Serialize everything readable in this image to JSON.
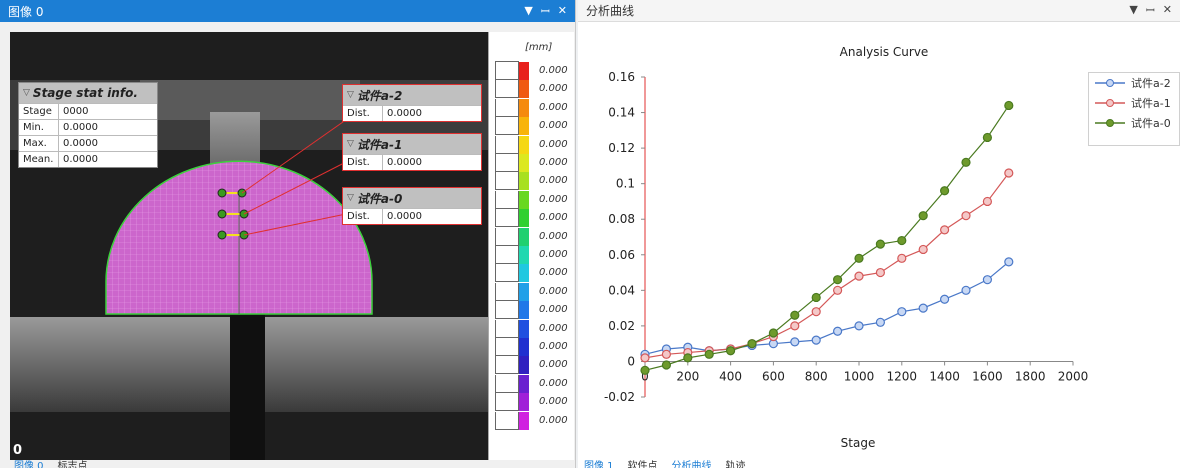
{
  "left_panel": {
    "title": "图像 0",
    "icons": {
      "dropdown": "▼",
      "pin": "ꟷ",
      "close": "✕"
    },
    "frame_label": "0",
    "stage_box": {
      "title": "Stage stat info.",
      "rows": [
        {
          "key": "Stage",
          "value": "0000"
        },
        {
          "key": "Min.",
          "value": "0.0000"
        },
        {
          "key": "Max.",
          "value": "0.0000"
        },
        {
          "key": "Mean.",
          "value": "0.0000"
        }
      ]
    },
    "specimens": [
      {
        "title": "试件a-2",
        "key": "Dist.",
        "value": "0.0000"
      },
      {
        "title": "试件a-1",
        "key": "Dist.",
        "value": "0.0000"
      },
      {
        "title": "试件a-0",
        "key": "Dist.",
        "value": "0.0000"
      }
    ],
    "bottom_tabs": [
      "图像 0",
      "标志点"
    ]
  },
  "scale_bar": {
    "unit": "[mm]",
    "values": [
      "0.000",
      "0.000",
      "0.000",
      "0.000",
      "0.000",
      "0.000",
      "0.000",
      "0.000",
      "0.000",
      "0.000",
      "0.000",
      "0.000",
      "0.000",
      "0.000",
      "0.000",
      "0.000",
      "0.000",
      "0.000",
      "0.000",
      "0.000"
    ],
    "colors": [
      "#e8201c",
      "#f05a12",
      "#f58a0e",
      "#f8b40a",
      "#f5d814",
      "#dce820",
      "#a8e020",
      "#68d820",
      "#30d030",
      "#20d070",
      "#20d8b0",
      "#20c8e0",
      "#20a0e8",
      "#2078e8",
      "#2050e0",
      "#2030d0",
      "#3020c0",
      "#6a20d0",
      "#a020d8",
      "#d020e0"
    ]
  },
  "right_panel": {
    "title": "分析曲线",
    "icons": {
      "dropdown": "▼",
      "pin": "ꟷ",
      "close": "✕"
    },
    "bottom_tabs": [
      "图像 1",
      "软件点",
      "分析曲线",
      "轨迹"
    ]
  },
  "chart_data": {
    "type": "scatter",
    "title": "Analysis Curve",
    "xlabel": "Stage",
    "ylabel": "",
    "xlim": [
      0,
      2000
    ],
    "ylim": [
      -0.02,
      0.16
    ],
    "xticks": [
      "0",
      "200",
      "400",
      "600",
      "800",
      "1000",
      "1200",
      "1400",
      "1600",
      "1800",
      "2000"
    ],
    "yticks": [
      "-0.02",
      "0",
      "0.02",
      "0.04",
      "0.06",
      "0.08",
      "0.1",
      "0.12",
      "0.14",
      "0.16"
    ],
    "grid": false,
    "legend_position": "top-right",
    "series": [
      {
        "name": "试件a-2",
        "color": "#4a78c8",
        "fill": "#c8d8f4",
        "x": [
          0,
          100,
          200,
          300,
          400,
          500,
          600,
          700,
          800,
          900,
          1000,
          1100,
          1200,
          1300,
          1400,
          1500,
          1600,
          1700
        ],
        "y": [
          0.004,
          0.007,
          0.008,
          0.006,
          0.007,
          0.009,
          0.01,
          0.011,
          0.012,
          0.017,
          0.02,
          0.022,
          0.028,
          0.03,
          0.035,
          0.04,
          0.046,
          0.056
        ]
      },
      {
        "name": "试件a-1",
        "color": "#d45858",
        "fill": "#f4c8c8",
        "x": [
          0,
          100,
          200,
          300,
          400,
          500,
          600,
          700,
          800,
          900,
          1000,
          1100,
          1200,
          1300,
          1400,
          1500,
          1600,
          1700
        ],
        "y": [
          0.002,
          0.004,
          0.005,
          0.006,
          0.007,
          0.01,
          0.014,
          0.02,
          0.028,
          0.04,
          0.048,
          0.05,
          0.058,
          0.063,
          0.074,
          0.082,
          0.09,
          0.106
        ]
      },
      {
        "name": "试件a-0",
        "color": "#4a7a20",
        "fill": "#6e9a2c",
        "x": [
          0,
          100,
          200,
          300,
          400,
          500,
          600,
          700,
          800,
          900,
          1000,
          1100,
          1200,
          1300,
          1400,
          1500,
          1600,
          1700
        ],
        "y": [
          -0.005,
          -0.002,
          0.002,
          0.004,
          0.006,
          0.01,
          0.016,
          0.026,
          0.036,
          0.046,
          0.058,
          0.066,
          0.068,
          0.082,
          0.096,
          0.112,
          0.126,
          0.144
        ]
      }
    ]
  }
}
